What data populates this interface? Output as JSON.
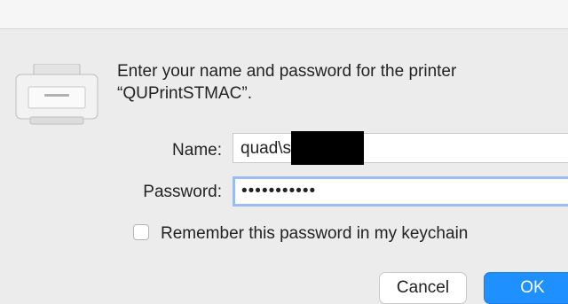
{
  "dialog": {
    "message": "Enter your name and password for the printer “QUPrintSTMAC”.",
    "name_label": "Name:",
    "name_value": "quad\\s",
    "password_label": "Password:",
    "password_value": "•••••••••••",
    "remember_label": "Remember this password in my keychain",
    "remember_checked": false,
    "cancel_label": "Cancel",
    "ok_label": "OK"
  },
  "colors": {
    "accent": "#1e90ff",
    "focus_ring": "#9bbcec",
    "background": "#ececec"
  },
  "icons": {
    "printer": "printer-icon"
  }
}
